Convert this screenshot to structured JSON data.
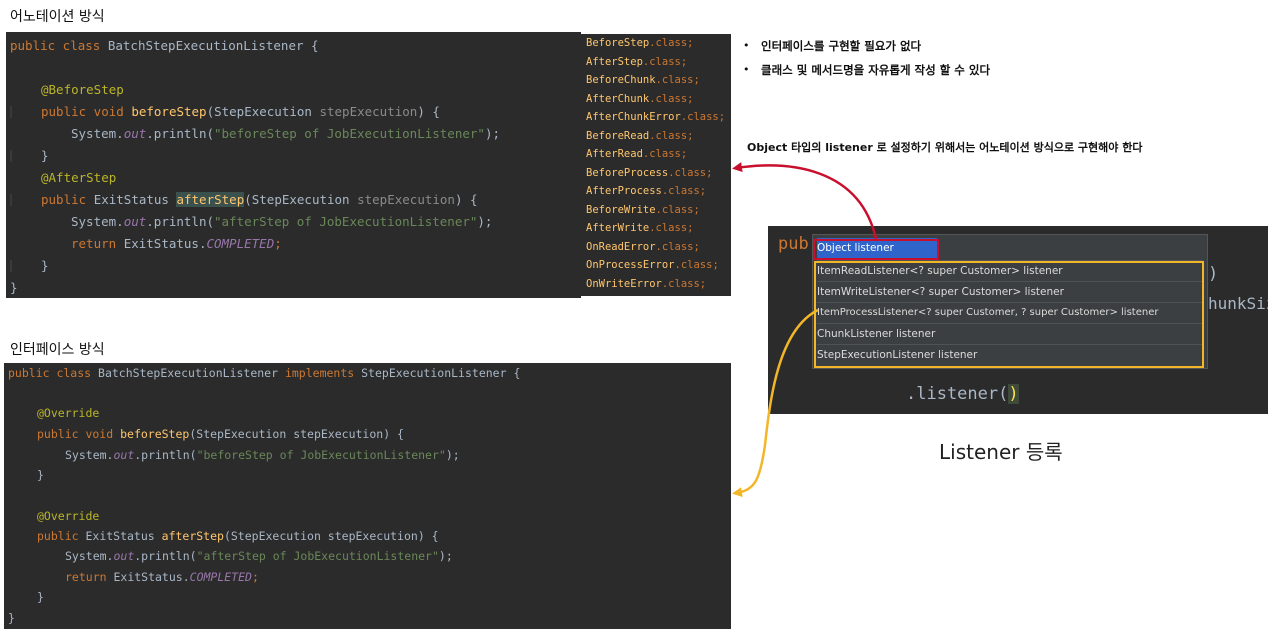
{
  "annotation_section": {
    "title": "어노테이션 방식",
    "code": {
      "class_decl_kw": "public class ",
      "class_name": "BatchStepExecutionListener {",
      "before_annotation": "@BeforeStep",
      "before_sig_kw": "public void ",
      "before_fn": "beforeStep",
      "before_params": "(StepExecution ",
      "before_param_name": "stepExecution",
      "before_close": ") {",
      "before_body_a": "System.",
      "before_body_out": "out",
      "before_body_b": ".println(",
      "before_body_str": "\"beforeStep of JobExecutionListener\"",
      "before_body_end": ");",
      "close_brace": "}",
      "after_annotation": "@AfterStep",
      "after_sig_kw": "public ",
      "after_sig_type": "ExitStatus ",
      "after_fn": "afterStep",
      "after_params": "(StepExecution ",
      "after_param_name": "stepExecution",
      "after_close": ") {",
      "after_body_a": "System.",
      "after_body_out": "out",
      "after_body_b": ".println(",
      "after_body_str": "\"afterStep of JobExecutionListener\"",
      "after_body_end": ");",
      "return_kw": "return ",
      "return_obj": "ExitStatus.",
      "return_enum": "COMPLETED",
      "return_end": ";",
      "class_close": "}"
    }
  },
  "annotation_list": [
    {
      "name": "BeforeStep",
      "suffix": ".class;"
    },
    {
      "name": "AfterStep",
      "suffix": ".class;"
    },
    {
      "name": "BeforeChunk",
      "suffix": ".class;"
    },
    {
      "name": "AfterChunk",
      "suffix": ".class;"
    },
    {
      "name": "AfterChunkError",
      "suffix": ".class;"
    },
    {
      "name": "BeforeRead",
      "suffix": ".class;"
    },
    {
      "name": "AfterRead",
      "suffix": ".class;"
    },
    {
      "name": "BeforeProcess",
      "suffix": ".class;"
    },
    {
      "name": "AfterProcess",
      "suffix": ".class;"
    },
    {
      "name": "BeforeWrite",
      "suffix": ".class;"
    },
    {
      "name": "AfterWrite",
      "suffix": ".class;"
    },
    {
      "name": "OnReadError",
      "suffix": ".class;"
    },
    {
      "name": "OnProcessError",
      "suffix": ".class;"
    },
    {
      "name": "OnWriteError",
      "suffix": ".class;"
    }
  ],
  "interface_section": {
    "title": "인터페이스 방식",
    "code": {
      "class_decl_kw": "public class ",
      "class_name": "BatchStepExecutionListener ",
      "implements_kw": "implements ",
      "iface_name": "StepExecutionListener {",
      "override1": "@Override",
      "before_sig_kw": "public void ",
      "before_fn": "beforeStep",
      "before_params": "(StepExecution stepExecution) {",
      "before_body_a": "System.",
      "before_body_out": "out",
      "before_body_b": ".println(",
      "before_body_str": "\"beforeStep of JobExecutionListener\"",
      "before_body_end": ");",
      "close_brace": "}",
      "override2": "@Override",
      "after_sig_kw": "public ",
      "after_sig_type": "ExitStatus ",
      "after_fn": "afterStep",
      "after_params": "(StepExecution stepExecution) {",
      "after_body_a": "System.",
      "after_body_out": "out",
      "after_body_b": ".println(",
      "after_body_str": "\"afterStep of JobExecutionListener\"",
      "after_body_end": ");",
      "return_kw": "return ",
      "return_obj": "ExitStatus.",
      "return_enum": "COMPLETED",
      "return_end": ";",
      "class_close": "}"
    }
  },
  "notes": {
    "bullet1": "인터페이스를 구현할 필요가 없다",
    "bullet2": "클래스 및 메서드명을 자유롭게 작성 할 수 있다",
    "object_note": "Object 타입의 listener 로 설정하기 위해서는 어노테이션 방식으로 구현해야 한다"
  },
  "autocomplete": {
    "bg_text_pub": "pub",
    "bg_text_paren": ")",
    "bg_text_chunk": "hunkSize",
    "bg_text_listener": ".listener(",
    "bg_text_cursor": ")",
    "items": [
      "Object listener",
      "ItemReadListener<? super Customer> listener",
      "ItemWriteListener<? super Customer> listener",
      "ItemProcessListener<? super Customer, ? super Customer> listener",
      "ChunkListener listener",
      "StepExecutionListener listener"
    ],
    "caption": "Listener 등록"
  },
  "colors": {
    "red_arrow": "#c8102e",
    "yellow_arrow": "#f2b628",
    "code_bg": "#2b2b2b"
  }
}
